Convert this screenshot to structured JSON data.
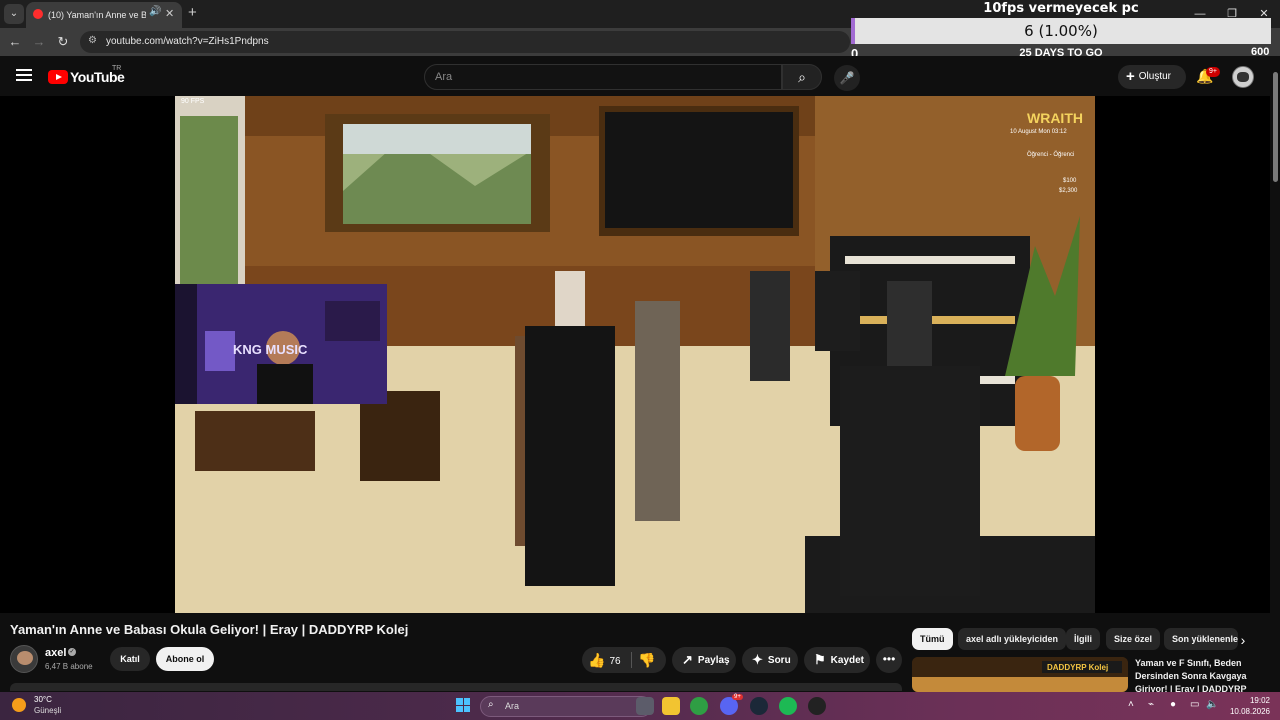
{
  "browser": {
    "tab_title": "(10) Yaman'ın Anne ve Babası",
    "url": "youtube.com/watch?v=ZiHs1Pndpns"
  },
  "stream_goal": {
    "label": "10fps vermeyecek pc",
    "progress_text": "6 (1.00%)",
    "progress_fraction": 0.01,
    "start": "0",
    "days_left": "25 DAYS TO GO",
    "end": "600"
  },
  "masthead": {
    "logo": "YouTube",
    "country": "TR",
    "search_placeholder": "Ara",
    "create_label": "Oluştur",
    "notifications_badge": "9+"
  },
  "video": {
    "fps_label": "90 FPS",
    "hud_brand": "WRAITH",
    "hud_date": "10 August Mon 03:12",
    "hud_job": "Öğrenci - Öğrenci",
    "hud_cash": "$100",
    "hud_bank": "$2,300",
    "webcam_sign": "KNG MUSIC"
  },
  "watch": {
    "title": "Yaman'ın Anne ve Babası Okula Geliyor! | Eray | DADDYRP Kolej",
    "channel_name": "axel",
    "subscribers": "6,47 B abone",
    "join_label": "Katıl",
    "subscribe_label": "Abone ol",
    "like_count": "76",
    "share_label": "Paylaş",
    "ask_label": "Soru",
    "save_label": "Kaydet"
  },
  "chips": [
    "Tümü",
    "axel adlı yükleyiciden",
    "İlgili",
    "Size özel",
    "Son yüklenenler"
  ],
  "recommended": {
    "thumb_text": "DADDYRP Kolej",
    "title": "Yaman ve F Sınıfı, Beden Dersinden Sonra Kavgaya Giriyor! | Eray | DADDYRP"
  },
  "taskbar": {
    "temperature": "30°C",
    "weather": "Güneşli",
    "search_text": "Ara",
    "discord_badge": "9+",
    "time": "19:02",
    "date": "10.08.2026"
  },
  "colors": {
    "accent_red": "#ff0000",
    "goal_fill": "#a26bd2",
    "background": "#0f0f0f"
  }
}
